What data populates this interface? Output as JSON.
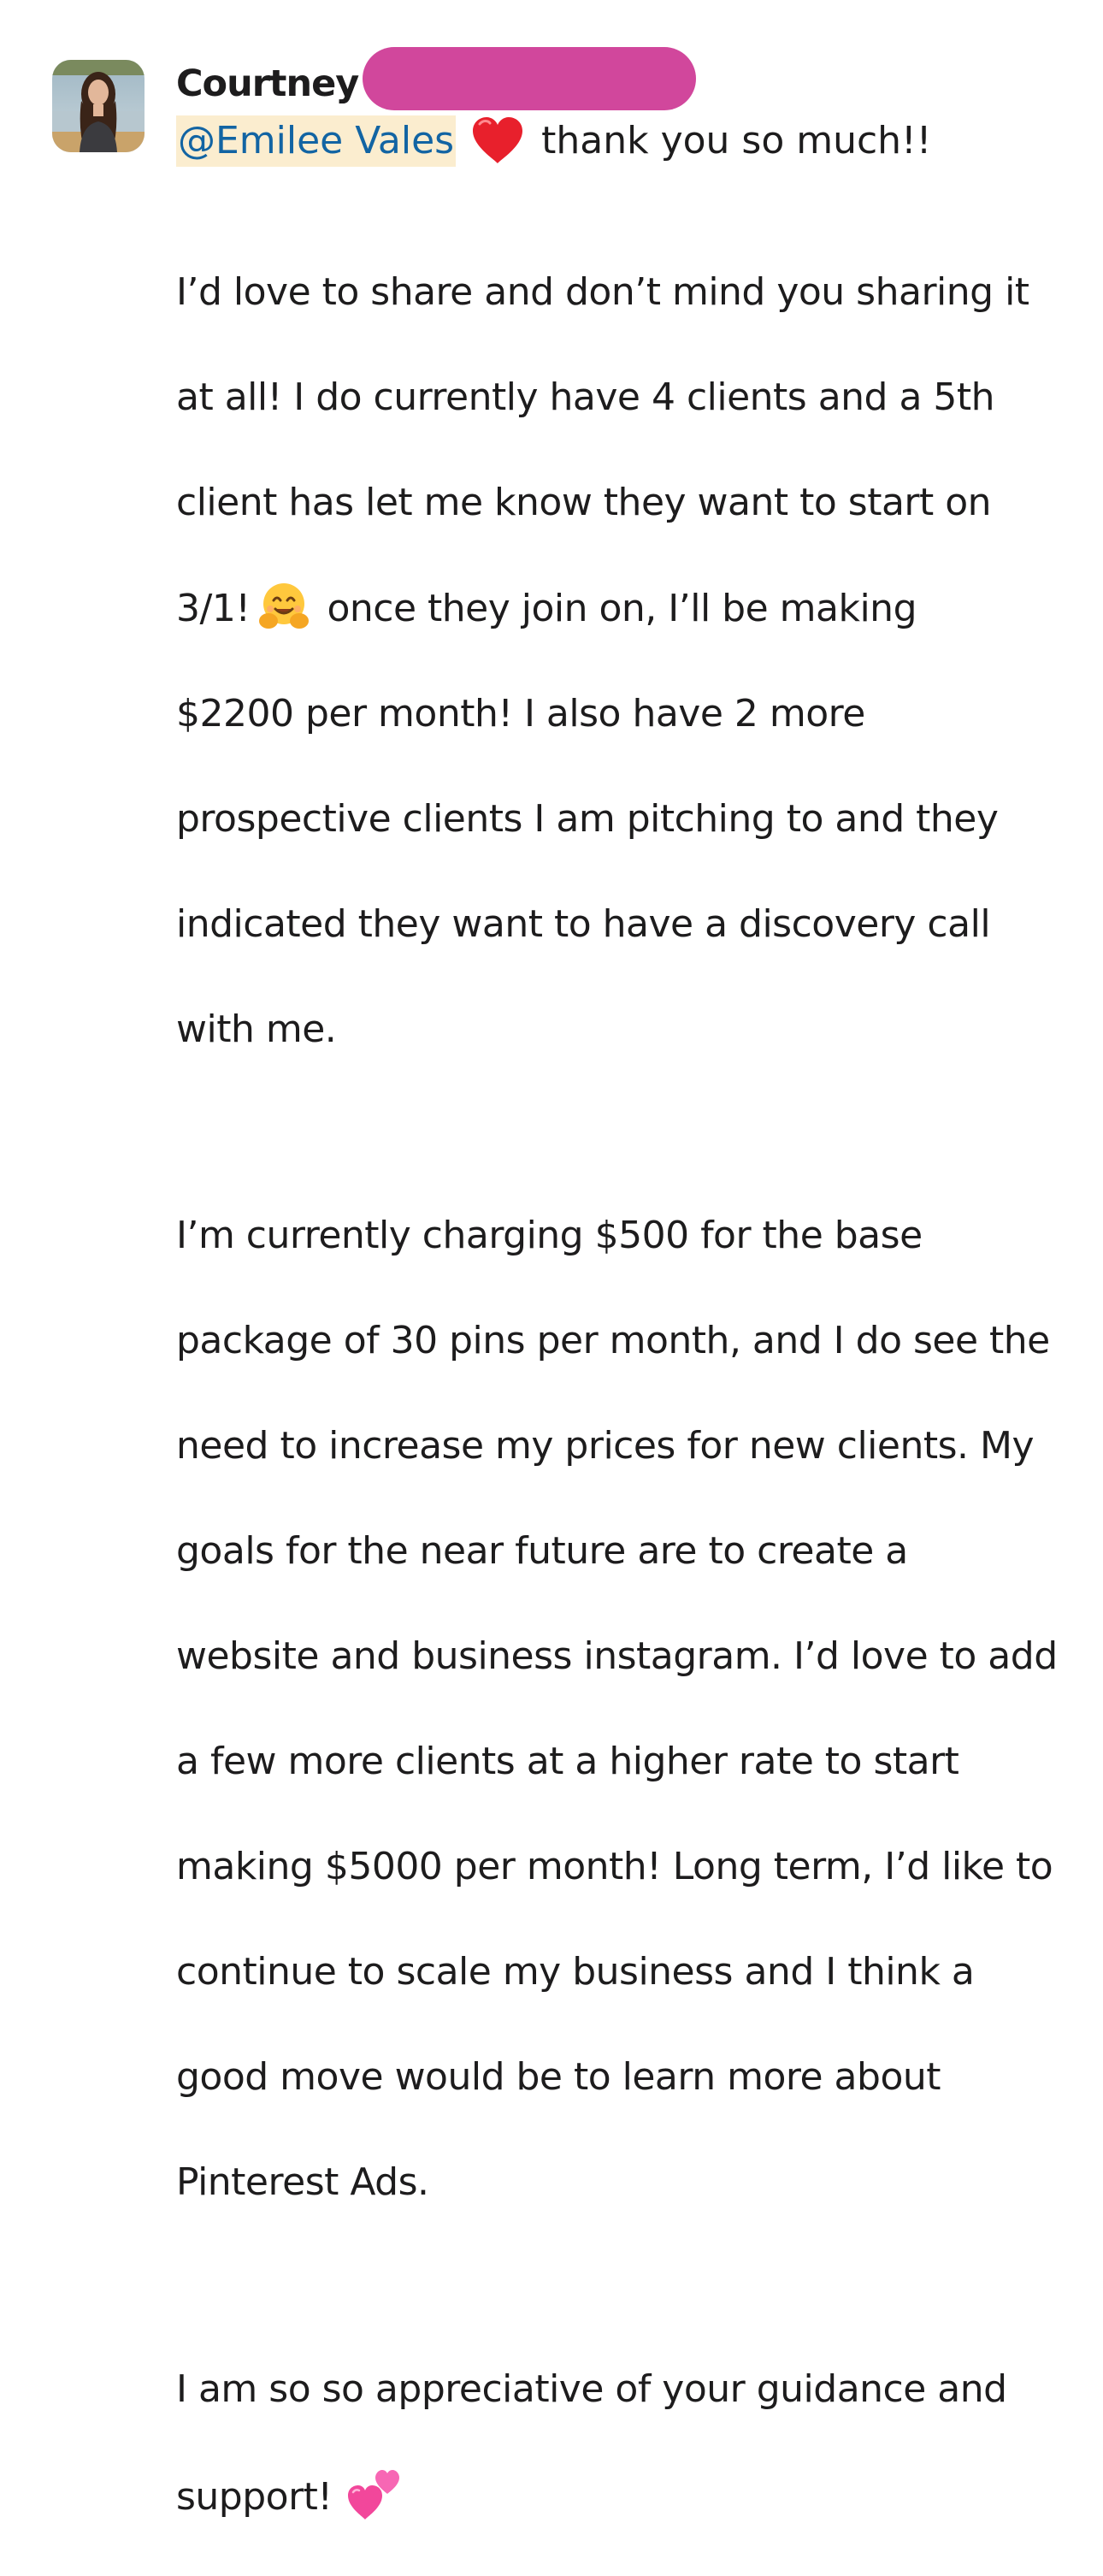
{
  "message": {
    "author": "Courtney",
    "mention": "@Emilee Vales",
    "first_line_text": "thank you so much!!",
    "paragraph1": {
      "line1": "I’d love to share and don’t mind you sharing it",
      "line2": "at all! I do currently have 4 clients and a 5th",
      "line3": "client has let me know they want to start on",
      "line4_before": "3/1!",
      "line4_after": "once they join on, I’ll be making",
      "line5": "$2200 per month! I also have 2 more",
      "line6": "prospective clients I am pitching to and they",
      "line7": "indicated they want to have a discovery call",
      "line8": "with me."
    },
    "paragraph2": {
      "line1": "I’m currently charging $500 for the base",
      "line2": "package of 30 pins per month, and I do see the",
      "line3": "need to increase my prices for new clients. My",
      "line4": "goals for the near future are to create a",
      "line5": "website and business instagram. I’d love to add",
      "line6": "a few more clients at a higher rate to start",
      "line7": "making $5000 per month! Long term, I’d like to",
      "line8": "continue to scale my business and I think a",
      "line9": "good move would be to learn more about",
      "line10": "Pinterest Ads."
    },
    "paragraph3": {
      "line1": "I am so so appreciative of your guidance and",
      "line2": "support!"
    },
    "emojis": {
      "heart": "red-heart-icon",
      "hug": "hugging-face-icon",
      "two_hearts": "two-hearts-icon"
    },
    "colors": {
      "text": "#1d1c1d",
      "mention_text": "#1264a3",
      "mention_bg": "#fbedcf",
      "redaction": "#d1479c"
    }
  }
}
